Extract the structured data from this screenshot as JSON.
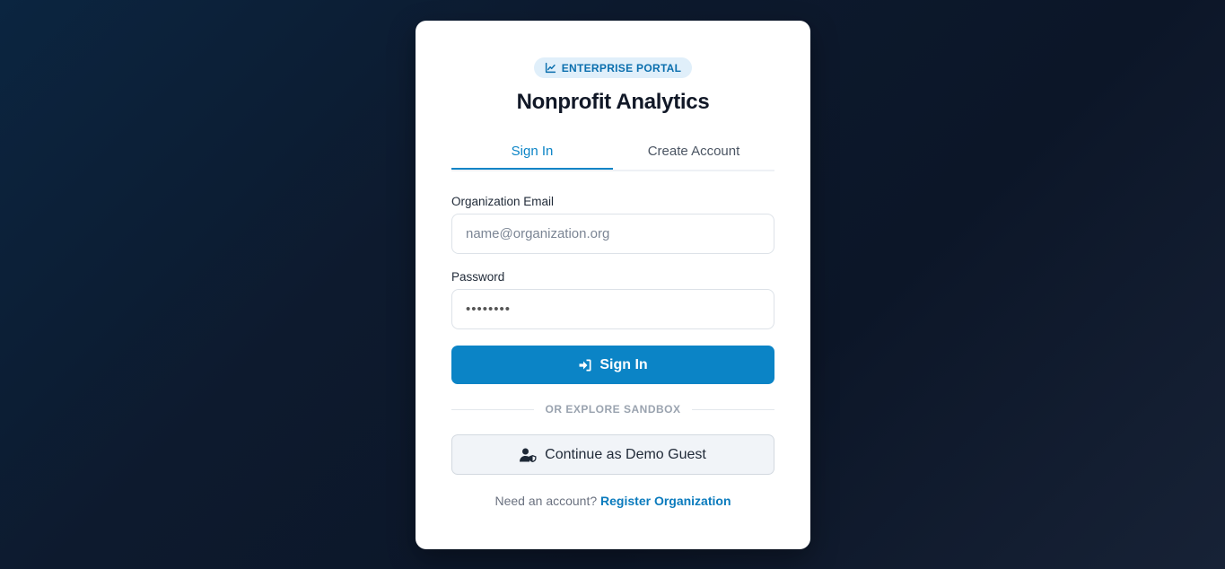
{
  "header": {
    "badge": "ENTERPRISE PORTAL",
    "badge_icon": "chart-line-icon",
    "title": "Nonprofit Analytics"
  },
  "tabs": [
    {
      "label": "Sign In",
      "active": true
    },
    {
      "label": "Create Account",
      "active": false
    }
  ],
  "form": {
    "email_label": "Organization Email",
    "email_placeholder": "name@organization.org",
    "email_value": "",
    "password_label": "Password",
    "password_value": "••••••••",
    "submit_label": "Sign In",
    "submit_icon": "sign-in-icon"
  },
  "divider_text": "OR EXPLORE SANDBOX",
  "demo": {
    "label": "Continue as Demo Guest",
    "icon": "user-shield-icon"
  },
  "footer": {
    "prompt": "Need an account?",
    "link": "Register Organization"
  },
  "colors": {
    "accent": "#0b84c6",
    "badge_bg": "#e0effa",
    "background": "#0d1a2e"
  }
}
